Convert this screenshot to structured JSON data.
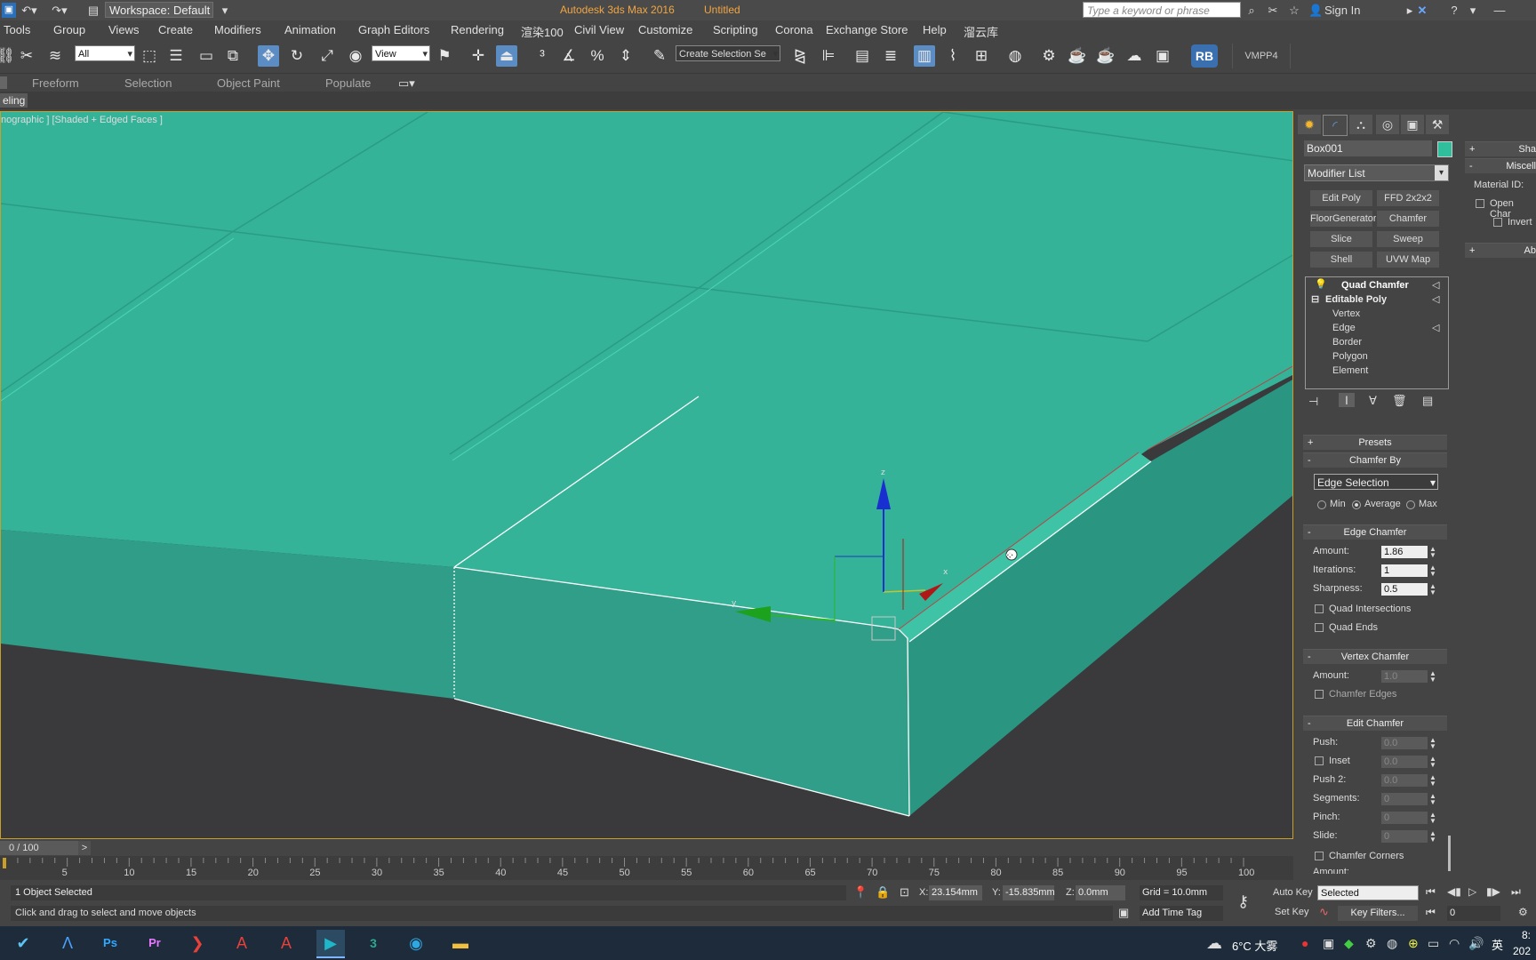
{
  "window": {
    "app_title": "Autodesk 3ds Max 2016",
    "doc_title": "Untitled",
    "workspace": "Workspace: Default",
    "search_placeholder": "Type a keyword or phrase",
    "sign_in": "Sign In"
  },
  "menu": [
    "Tools",
    "Group",
    "Views",
    "Create",
    "Modifiers",
    "Animation",
    "Graph Editors",
    "Rendering",
    "渲染100",
    "Civil View",
    "Customize",
    "Scripting",
    "Corona",
    "Exchange Store",
    "Help",
    "溜云库"
  ],
  "toolbar": {
    "filter_select": "All",
    "ref_coord": "View",
    "selection_set_placeholder": "Create Selection Se",
    "rb_label": "RB",
    "vmpp_label": "VMPP4"
  },
  "ribbon_tabs": [
    "Freeform",
    "Selection",
    "Object Paint",
    "Populate"
  ],
  "ribbon_subtab": "eling",
  "viewport": {
    "label": "nographic ] [Shaded + Edged Faces ]",
    "gizmo_axes": {
      "x": "x",
      "y": "y",
      "z": "z"
    }
  },
  "command_panel": {
    "object_name": "Box001",
    "object_color": "#2fbf9c",
    "modifier_list": "Modifier List",
    "mod_buttons": [
      "Edit Poly",
      "FFD 2x2x2",
      "FloorGenerator",
      "Chamfer",
      "Slice",
      "Sweep",
      "Shell",
      "UVW Map"
    ],
    "stack": {
      "top": "Quad Chamfer",
      "base": "Editable Poly",
      "subobjects": [
        "Vertex",
        "Edge",
        "Border",
        "Polygon",
        "Element"
      ]
    },
    "presets": "Presets",
    "chamfer_by": {
      "header": "Chamfer By",
      "value": "Edge Selection",
      "radios": [
        "Min",
        "Average",
        "Max"
      ],
      "selected_radio": "Average"
    },
    "edge_chamfer": {
      "header": "Edge Chamfer",
      "fields": [
        {
          "label": "Amount:",
          "value": "1.86"
        },
        {
          "label": "Iterations:",
          "value": "1"
        },
        {
          "label": "Sharpness:",
          "value": "0.5"
        }
      ],
      "checks": [
        "Quad Intersections",
        "Quad Ends"
      ]
    },
    "vertex_chamfer": {
      "header": "Vertex Chamfer",
      "amount_label": "Amount:",
      "amount_value": "1.0",
      "check": "Chamfer Edges"
    },
    "edit_chamfer": {
      "header": "Edit Chamfer",
      "fields": [
        {
          "label": "Push:",
          "value": "0.0"
        },
        {
          "label": "Inset",
          "value": "0.0"
        },
        {
          "label": "Push 2:",
          "value": "0.0"
        },
        {
          "label": "Segments:",
          "value": "0"
        },
        {
          "label": "Pinch:",
          "value": "0"
        },
        {
          "label": "Slide:",
          "value": "0"
        }
      ],
      "check": "Chamfer Corners",
      "partial": "Amount:"
    }
  },
  "right_col": {
    "shade": "Sha",
    "misc": "Miscell",
    "material_id": "Material ID:",
    "open_chamfer": "Open Char",
    "invert": "Invert",
    "about": "Ab"
  },
  "timeline": {
    "frame": "0 / 100",
    "ticks": [
      "5",
      "10",
      "15",
      "20",
      "25",
      "30",
      "35",
      "40",
      "45",
      "50",
      "55",
      "60",
      "65",
      "70",
      "75",
      "80",
      "85",
      "90",
      "95",
      "100"
    ]
  },
  "status": {
    "selection": "1 Object Selected",
    "prompt": "Click and drag to select and move objects",
    "x_label": "X:",
    "x_value": "23.154mm",
    "y_label": "Y:",
    "y_value": "-15.835mm",
    "z_label": "Z:",
    "z_value": "0.0mm",
    "grid": "Grid = 10.0mm",
    "add_time_tag": "Add Time Tag",
    "auto_key": "Auto Key",
    "set_key": "Set Key",
    "key_mode": "Selected",
    "key_filters": "Key Filters...",
    "frame_field": "0"
  },
  "taskbar": {
    "weather": "6°C 大雾",
    "ime": "英",
    "time": "8:",
    "date": "202"
  }
}
